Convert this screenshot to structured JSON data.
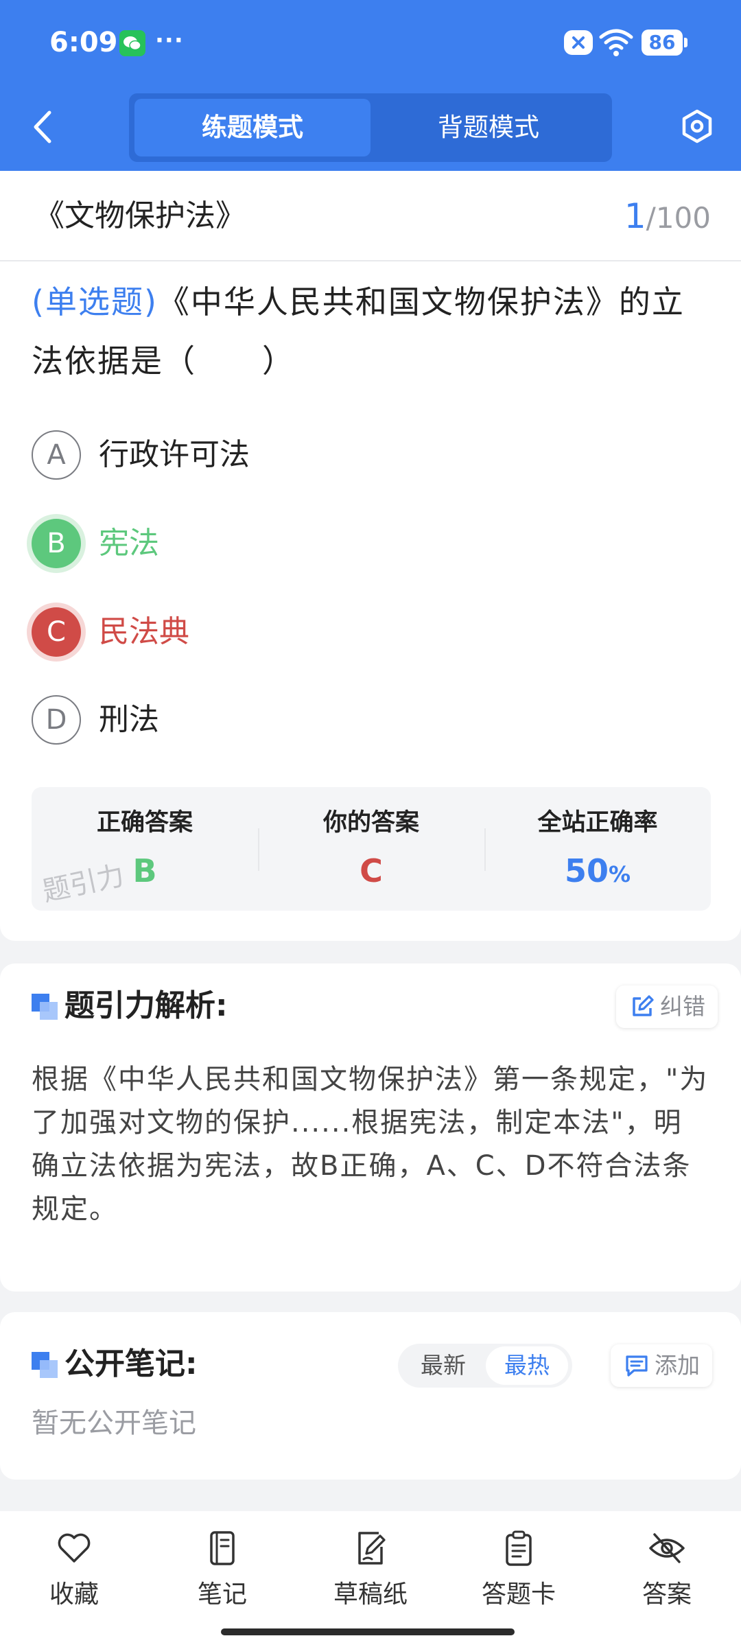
{
  "status_bar": {
    "time": "6:09",
    "dots": "···",
    "battery": "86",
    "icons": [
      "wechat-icon",
      "notification-blocked-icon",
      "wifi-icon",
      "battery-icon"
    ]
  },
  "header": {
    "back_icon": "chevron-left-icon",
    "modes": [
      {
        "label": "练题模式",
        "active": true
      },
      {
        "label": "背题模式",
        "active": false
      }
    ],
    "settings_icon": "hexagon-settings-icon",
    "accent_color": "#3d7fef"
  },
  "question": {
    "law_title": "《文物保护法》",
    "current": "1",
    "total": "/100",
    "type": "(单选题)",
    "text": "《中华人民共和国文物保护法》的立法依据是（　　）",
    "options": [
      {
        "letter": "A",
        "text": "行政许可法",
        "state": "normal"
      },
      {
        "letter": "B",
        "text": "宪法",
        "state": "correct"
      },
      {
        "letter": "C",
        "text": "民法典",
        "state": "wrong"
      },
      {
        "letter": "D",
        "text": "刑法",
        "state": "normal"
      }
    ]
  },
  "answer_summary": {
    "correct_label": "正确答案",
    "correct_value": "B",
    "yours_label": "你的答案",
    "yours_value": "C",
    "rate_label": "全站正确率",
    "rate_value": "50",
    "rate_unit": "%",
    "watermark": "题引力",
    "colors": {
      "correct": "#5dc87d",
      "wrong": "#d04b47",
      "rate": "#3d7fef"
    }
  },
  "analysis": {
    "title": "题引力解析:",
    "report_label": "纠错",
    "text": "根据《中华人民共和国文物保护法》第一条规定，\"为了加强对文物的保护......根据宪法，制定本法\"，明确立法依据为宪法，故B正确，A、C、D不符合法条规定。"
  },
  "notes": {
    "title": "公开笔记:",
    "sort_options": [
      {
        "label": "最新",
        "active": false
      },
      {
        "label": "最热",
        "active": true
      }
    ],
    "add_label": "添加",
    "empty_text": "暂无公开笔记"
  },
  "bottom_bar": {
    "items": [
      {
        "label": "收藏",
        "icon": "heart-icon"
      },
      {
        "label": "笔记",
        "icon": "notebook-icon"
      },
      {
        "label": "草稿纸",
        "icon": "draft-pen-icon"
      },
      {
        "label": "答题卡",
        "icon": "clipboard-icon"
      },
      {
        "label": "答案",
        "icon": "eye-off-icon"
      }
    ]
  }
}
